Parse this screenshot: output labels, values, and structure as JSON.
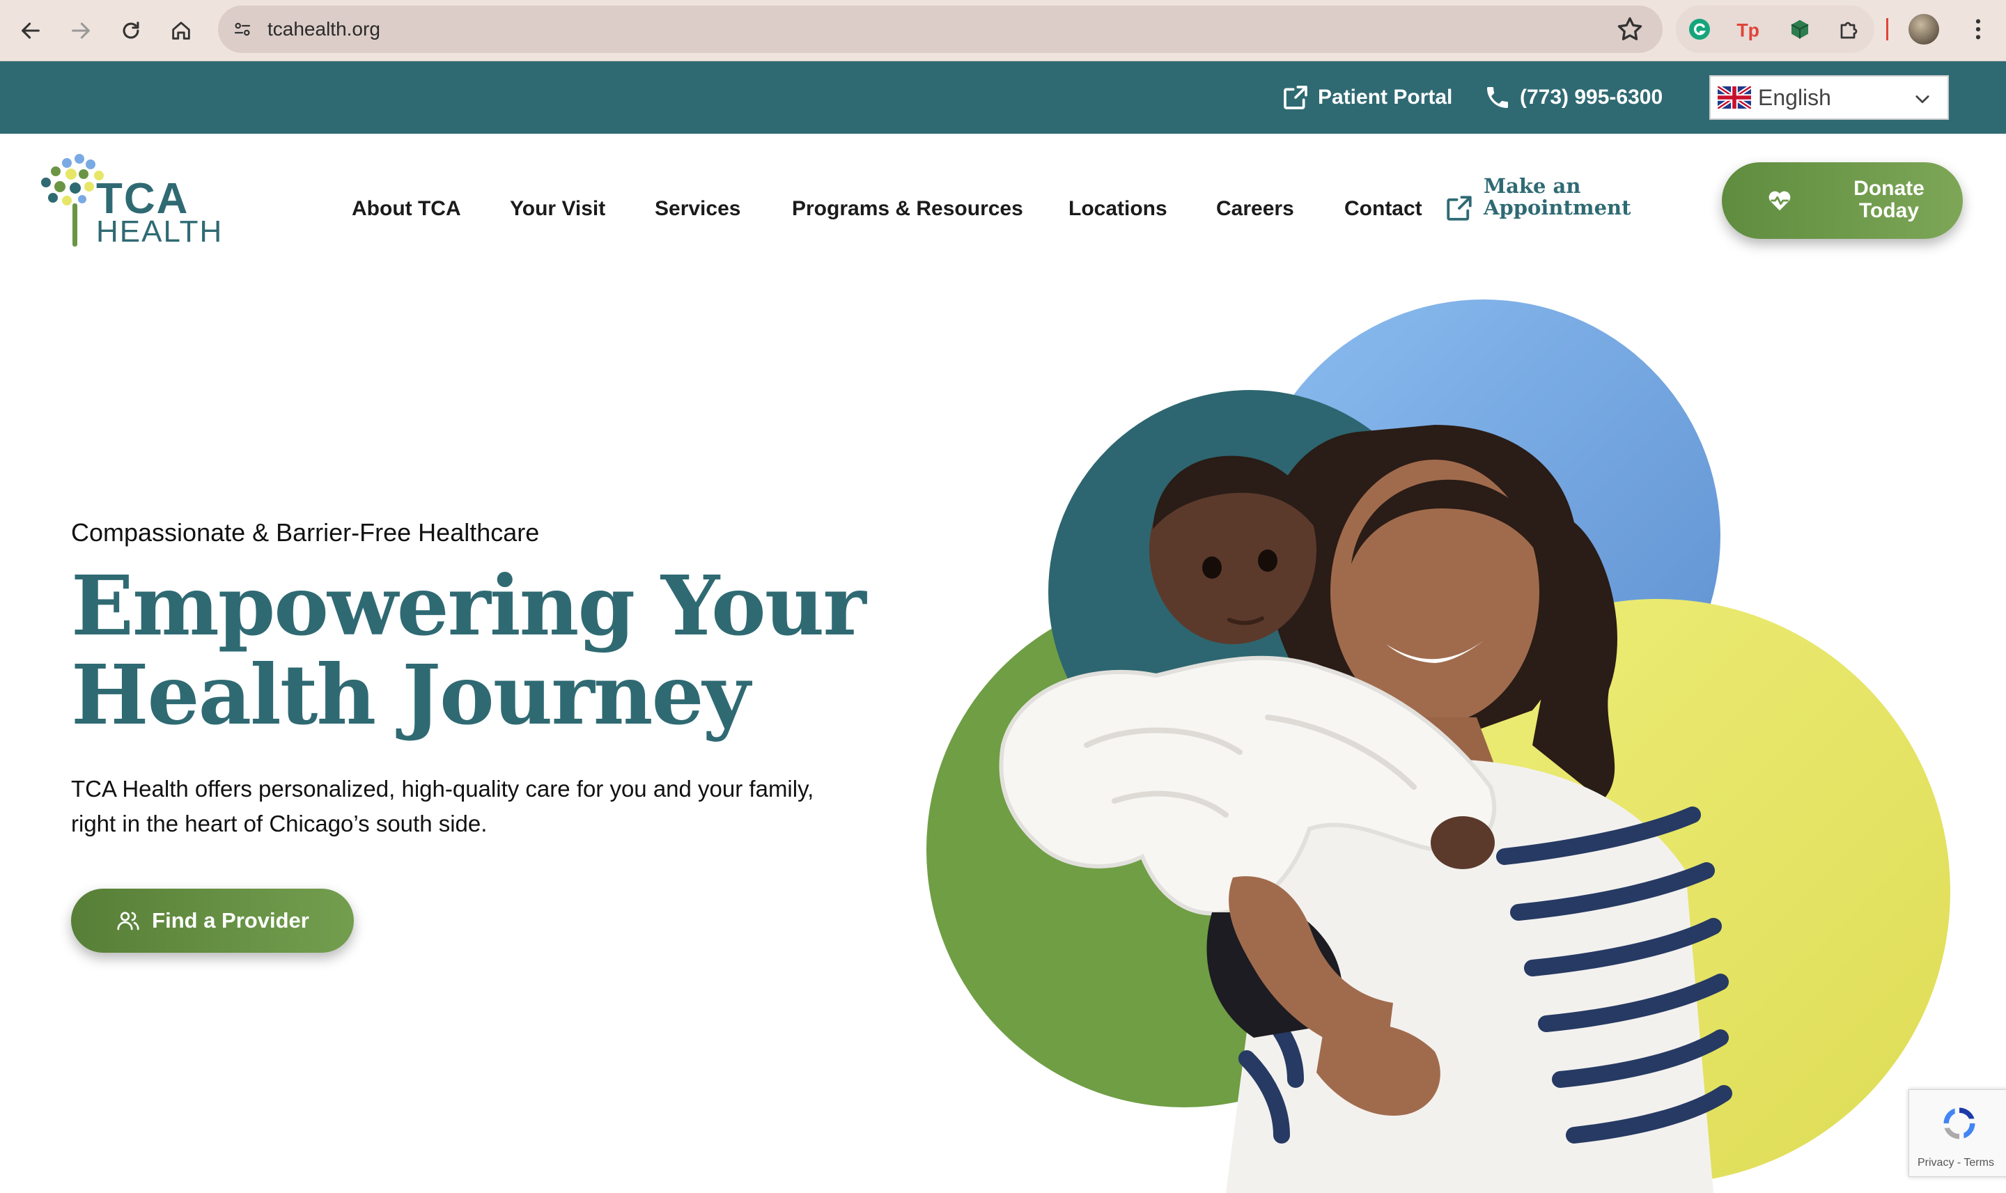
{
  "browser": {
    "url": "tcahealth.org",
    "extensions": [
      "grammarly-icon",
      "tp-icon",
      "cube-icon",
      "puzzle-icon"
    ]
  },
  "utility_bar": {
    "patient_portal": "Patient Portal",
    "phone": "(773) 995-6300",
    "language": "English"
  },
  "brand": {
    "logo_line1": "TCA",
    "logo_line2": "HEALTH",
    "colors": {
      "teal": "#2f6a73",
      "green": "#6a9545",
      "blue": "#7aaae3",
      "yellow": "#e7e667"
    }
  },
  "nav": {
    "items": [
      "About TCA",
      "Your Visit",
      "Services",
      "Programs & Resources",
      "Locations",
      "Careers",
      "Contact"
    ],
    "appointment_line1": "Make an",
    "appointment_line2": "Appointment",
    "donate_line1": "Donate",
    "donate_line2": "Today"
  },
  "hero": {
    "eyebrow": "Compassionate & Barrier-Free Healthcare",
    "headline_line1": "Empowering Your",
    "headline_line2": "Health Journey",
    "intro_line1": "TCA Health offers personalized, high-quality care for you and your family,",
    "intro_line2": "right in the heart of Chicago’s south side.",
    "cta": "Find a Provider"
  },
  "recaptcha": {
    "terms": "Privacy - Terms"
  }
}
